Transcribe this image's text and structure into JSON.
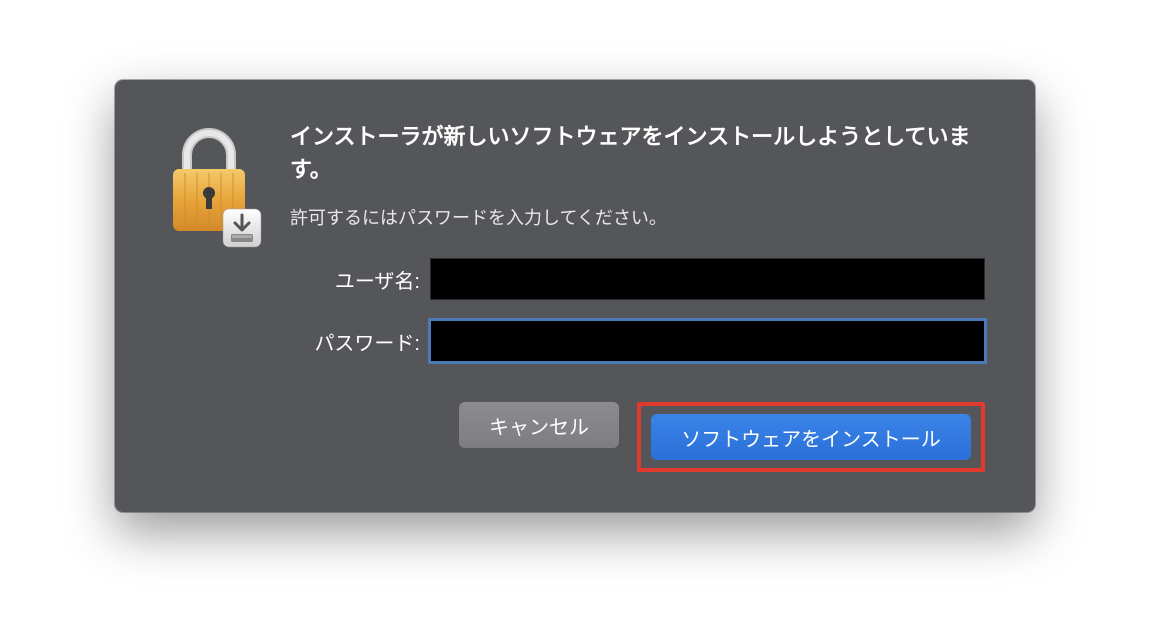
{
  "dialog": {
    "title": "インストーラが新しいソフトウェアをインストールしようとしています。",
    "subtitle": "許可するにはパスワードを入力してください。",
    "username_label": "ユーザ名:",
    "password_label": "パスワード:",
    "username_value": "",
    "password_value": "",
    "cancel_label": "キャンセル",
    "install_label": "ソフトウェアをインストール"
  },
  "icons": {
    "lock": "lock-icon",
    "installer_badge": "installer-badge-icon"
  },
  "colors": {
    "dialog_bg": "#555659",
    "primary_button": "#2a6fd8",
    "highlight_border": "#e03a2f",
    "focus_ring": "#4a7ab8"
  }
}
